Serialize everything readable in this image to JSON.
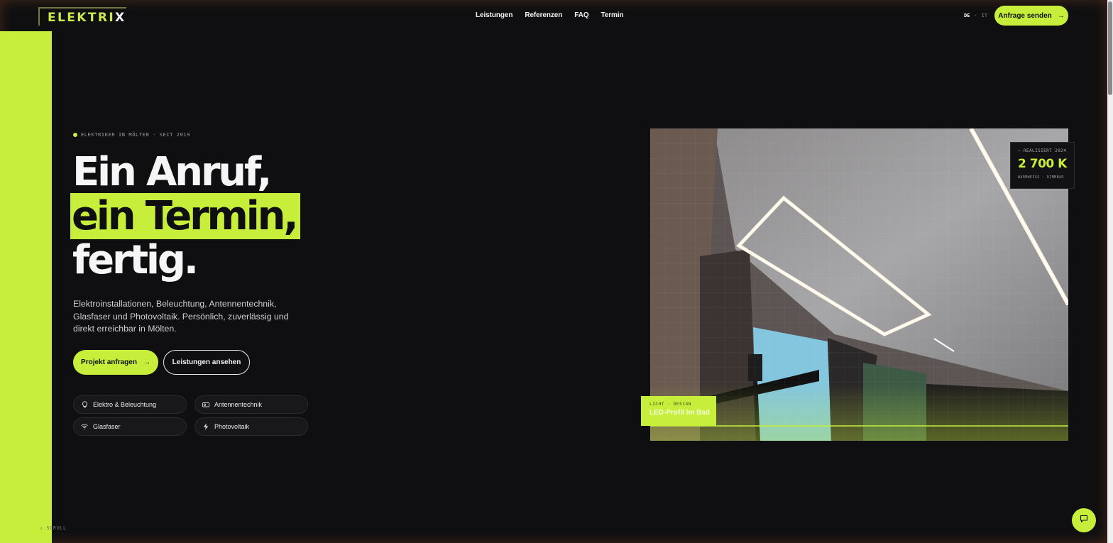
{
  "header": {
    "logo_main": "ELEKTRI",
    "logo_x": "X",
    "nav": [
      "Leistungen",
      "Referenzen",
      "FAQ",
      "Termin"
    ],
    "lang_active": "DE",
    "lang_sep": "·",
    "lang_other": "IT",
    "cta_label": "Anfrage senden",
    "cta_arrow": "→"
  },
  "hero": {
    "eyebrow": "ELEKTRIKER IN MÖLTEN · SEIT 2019",
    "title_line1": "Ein Anruf,",
    "title_line2": "ein Termin,",
    "title_line3": "fertig.",
    "lead": "Elektroinstallationen, Beleuchtung, Antennentechnik, Glasfaser und Photovoltaik. Persönlich, zuverlässig und direkt erreichbar in Mölten.",
    "cta_primary": "Projekt anfragen",
    "cta_primary_arrow": "→",
    "cta_secondary": "Leistungen ansehen",
    "services": [
      {
        "label": "Elektro & Beleuchtung",
        "icon": "lightbulb-icon"
      },
      {
        "label": "Antennentechnik",
        "icon": "antenna-icon"
      },
      {
        "label": "Glasfaser",
        "icon": "wifi-icon"
      },
      {
        "label": "Photovoltaik",
        "icon": "lightning-icon"
      }
    ]
  },
  "showcase": {
    "stat_eyebrow": "— REALISIERT 2024",
    "stat_value": "2 700 K",
    "stat_sub": "WARMWEISS · DIMMBAR",
    "tag_eyebrow": "LICHT · DESIGN",
    "tag_title": "LED-Profil im Bad"
  },
  "scroll_label": "↓ SCROLL",
  "colors": {
    "accent": "#c6ee3a",
    "background": "#0f0f11"
  }
}
